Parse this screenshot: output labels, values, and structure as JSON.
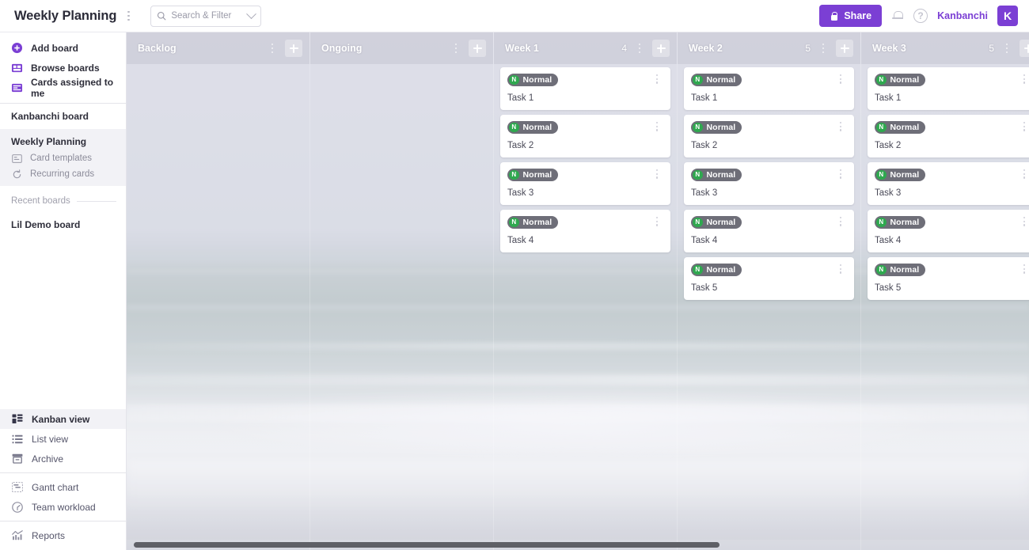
{
  "topbar": {
    "board_title": "Weekly Planning",
    "title_menu_icon": "dots-vertical-icon",
    "search": {
      "icon": "search-icon",
      "placeholder": "Search & Filter",
      "value": "",
      "dropdown_icon": "chevron-down-icon"
    },
    "share_label": "Share",
    "share_icon": "lock-icon",
    "share_color": "#7b3fd4",
    "notifications_icon": "bell-icon",
    "help_icon": "help-circle-icon",
    "user_name": "Kanbanchi",
    "avatar_initial": "K"
  },
  "sidebar": {
    "top_items": [
      {
        "label": "Add board",
        "icon": "plus-circle-icon"
      },
      {
        "label": "Browse boards",
        "icon": "browse-boards-icon"
      },
      {
        "label": "Cards assigned to me",
        "icon": "assigned-cards-icon"
      }
    ],
    "boards": [
      {
        "label": "Kanbanchi board",
        "active": false
      },
      {
        "label": "Weekly Planning",
        "active": true
      }
    ],
    "board_sub_items": [
      {
        "label": "Card templates",
        "icon": "template-icon"
      },
      {
        "label": "Recurring cards",
        "icon": "recurring-icon"
      }
    ],
    "recent_label": "Recent boards",
    "recent_boards": [
      {
        "label": "Lil Demo board"
      }
    ],
    "views": [
      {
        "label": "Kanban view",
        "icon": "kanban-view-icon",
        "active": true
      },
      {
        "label": "List view",
        "icon": "list-view-icon",
        "active": false
      },
      {
        "label": "Archive",
        "icon": "archive-icon",
        "active": false
      },
      {
        "label": "Gantt chart",
        "icon": "gantt-chart-icon",
        "active": false
      },
      {
        "label": "Team workload",
        "icon": "team-workload-icon",
        "active": false
      },
      {
        "label": "Reports",
        "icon": "reports-icon",
        "active": false
      }
    ]
  },
  "board": {
    "add_card_icon": "plus-icon",
    "column_menu_icon": "dots-vertical-icon",
    "card_menu_icon": "dots-vertical-icon",
    "badge_letter": "N",
    "badge_label": "Normal",
    "badge_dot_color": "#2fa84f",
    "badge_bg_color": "#6e6e78",
    "columns": [
      {
        "title": "Backlog",
        "count": "",
        "cards": []
      },
      {
        "title": "Ongoing",
        "count": "",
        "cards": []
      },
      {
        "title": "Week 1",
        "count": "4",
        "cards": [
          {
            "title": "Task 1"
          },
          {
            "title": "Task 2"
          },
          {
            "title": "Task 3"
          },
          {
            "title": "Task 4"
          }
        ]
      },
      {
        "title": "Week 2",
        "count": "5",
        "cards": [
          {
            "title": "Task 1"
          },
          {
            "title": "Task 2"
          },
          {
            "title": "Task 3"
          },
          {
            "title": "Task 4"
          },
          {
            "title": "Task 5"
          }
        ]
      },
      {
        "title": "Week 3",
        "count": "5",
        "cards": [
          {
            "title": "Task 1"
          },
          {
            "title": "Task 2"
          },
          {
            "title": "Task 3"
          },
          {
            "title": "Task 4"
          },
          {
            "title": "Task 5"
          }
        ]
      }
    ]
  }
}
